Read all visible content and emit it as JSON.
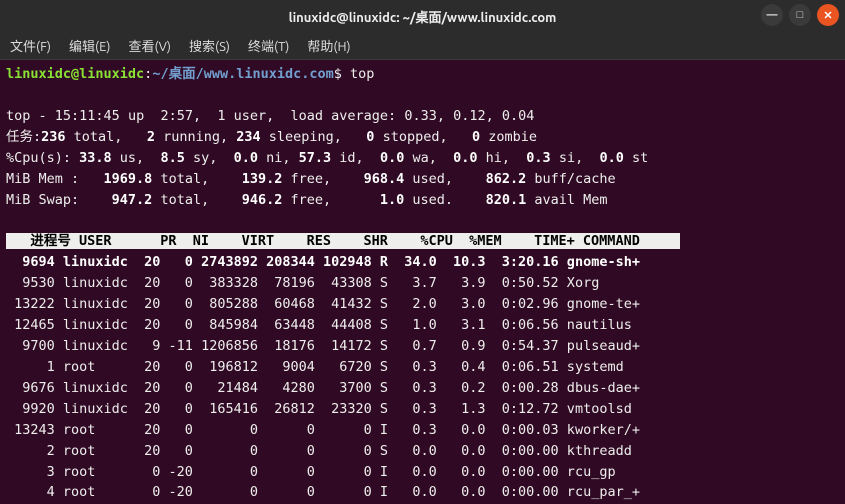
{
  "titlebar": {
    "title": "linuxidc@linuxidc: ~/桌面/www.linuxidc.com"
  },
  "window_controls": {
    "min": "—",
    "max": "□",
    "close": "✕"
  },
  "menu": {
    "file": "文件(F)",
    "edit": "编辑(E)",
    "view": "查看(V)",
    "search": "搜索(S)",
    "terminal": "终端(T)",
    "help": "帮助(H)"
  },
  "prompt": {
    "userhost": "linuxidc@linuxidc",
    "colon": ":",
    "path": "~/桌面/www.linuxidc.com",
    "dollar": "$",
    "command": "top"
  },
  "top_summary": {
    "line1_prefix": "top - ",
    "time": "15:11:45",
    "up_label": " up  ",
    "uptime": "2:57",
    "users_sep": ",  ",
    "users": "1 user",
    "load_label": ",  load average: ",
    "load": "0.33, 0.12, 0.04",
    "tasks_label": "任务:",
    "tasks_total": "236",
    "tasks_total_lbl": " total,   ",
    "tasks_running": "2",
    "tasks_running_lbl": " running, ",
    "tasks_sleeping": "234",
    "tasks_sleeping_lbl": " sleeping,   ",
    "tasks_stopped": "0",
    "tasks_stopped_lbl": " stopped,   ",
    "tasks_zombie": "0",
    "tasks_zombie_lbl": " zombie",
    "cpu_label": "%Cpu(s): ",
    "cpu_us": "33.8",
    "cpu_us_lbl": " us,  ",
    "cpu_sy": "8.5",
    "cpu_sy_lbl": " sy,  ",
    "cpu_ni": "0.0",
    "cpu_ni_lbl": " ni, ",
    "cpu_id": "57.3",
    "cpu_id_lbl": " id,  ",
    "cpu_wa": "0.0",
    "cpu_wa_lbl": " wa,  ",
    "cpu_hi": "0.0",
    "cpu_hi_lbl": " hi,  ",
    "cpu_si": "0.3",
    "cpu_si_lbl": " si,  ",
    "cpu_st": "0.0",
    "cpu_st_lbl": " st",
    "mem_label": "MiB Mem :   ",
    "mem_total": "1969.8",
    "mem_total_lbl": " total,    ",
    "mem_free": "139.2",
    "mem_free_lbl": " free,    ",
    "mem_used": "968.4",
    "mem_used_lbl": " used,    ",
    "mem_buff": "862.2",
    "mem_buff_lbl": " buff/cache",
    "swap_label": "MiB Swap:    ",
    "swap_total": "947.2",
    "swap_total_lbl": " total,    ",
    "swap_free": "946.2",
    "swap_free_lbl": " free,      ",
    "swap_used": "1.0",
    "swap_used_lbl": " used.    ",
    "swap_avail": "820.1",
    "swap_avail_lbl": " avail Mem"
  },
  "columns": {
    "pid": "进程号",
    "user": "USER",
    "pr": "PR",
    "ni": "NI",
    "virt": "VIRT",
    "res": "RES",
    "shr": "SHR",
    "s": " ",
    "cpu": "%CPU",
    "mem": "%MEM",
    "time": "TIME+",
    "cmd": "COMMAND"
  },
  "processes": [
    {
      "pid": "9694",
      "user": "linuxidc",
      "pr": "20",
      "ni": "0",
      "virt": "2743892",
      "res": "208344",
      "shr": "102948",
      "s": "R",
      "cpu": "34.0",
      "mem": "10.3",
      "time": "3:20.16",
      "cmd": "gnome-sh+",
      "hl": true
    },
    {
      "pid": "9530",
      "user": "linuxidc",
      "pr": "20",
      "ni": "0",
      "virt": "383328",
      "res": "78196",
      "shr": "43308",
      "s": "S",
      "cpu": "3.7",
      "mem": "3.9",
      "time": "0:50.52",
      "cmd": "Xorg"
    },
    {
      "pid": "13222",
      "user": "linuxidc",
      "pr": "20",
      "ni": "0",
      "virt": "805288",
      "res": "60468",
      "shr": "41432",
      "s": "S",
      "cpu": "2.0",
      "mem": "3.0",
      "time": "0:02.96",
      "cmd": "gnome-te+"
    },
    {
      "pid": "12465",
      "user": "linuxidc",
      "pr": "20",
      "ni": "0",
      "virt": "845984",
      "res": "63448",
      "shr": "44408",
      "s": "S",
      "cpu": "1.0",
      "mem": "3.1",
      "time": "0:06.56",
      "cmd": "nautilus"
    },
    {
      "pid": "9700",
      "user": "linuxidc",
      "pr": "9",
      "ni": "-11",
      "virt": "1206856",
      "res": "18176",
      "shr": "14172",
      "s": "S",
      "cpu": "0.7",
      "mem": "0.9",
      "time": "0:54.37",
      "cmd": "pulseaud+"
    },
    {
      "pid": "1",
      "user": "root",
      "pr": "20",
      "ni": "0",
      "virt": "196812",
      "res": "9004",
      "shr": "6720",
      "s": "S",
      "cpu": "0.3",
      "mem": "0.4",
      "time": "0:06.51",
      "cmd": "systemd"
    },
    {
      "pid": "9676",
      "user": "linuxidc",
      "pr": "20",
      "ni": "0",
      "virt": "21484",
      "res": "4280",
      "shr": "3700",
      "s": "S",
      "cpu": "0.3",
      "mem": "0.2",
      "time": "0:00.28",
      "cmd": "dbus-dae+"
    },
    {
      "pid": "9920",
      "user": "linuxidc",
      "pr": "20",
      "ni": "0",
      "virt": "165416",
      "res": "26812",
      "shr": "23320",
      "s": "S",
      "cpu": "0.3",
      "mem": "1.3",
      "time": "0:12.72",
      "cmd": "vmtoolsd"
    },
    {
      "pid": "13243",
      "user": "root",
      "pr": "20",
      "ni": "0",
      "virt": "0",
      "res": "0",
      "shr": "0",
      "s": "I",
      "cpu": "0.3",
      "mem": "0.0",
      "time": "0:00.03",
      "cmd": "kworker/+"
    },
    {
      "pid": "2",
      "user": "root",
      "pr": "20",
      "ni": "0",
      "virt": "0",
      "res": "0",
      "shr": "0",
      "s": "S",
      "cpu": "0.0",
      "mem": "0.0",
      "time": "0:00.00",
      "cmd": "kthreadd"
    },
    {
      "pid": "3",
      "user": "root",
      "pr": "0",
      "ni": "-20",
      "virt": "0",
      "res": "0",
      "shr": "0",
      "s": "I",
      "cpu": "0.0",
      "mem": "0.0",
      "time": "0:00.00",
      "cmd": "rcu_gp"
    },
    {
      "pid": "4",
      "user": "root",
      "pr": "0",
      "ni": "-20",
      "virt": "0",
      "res": "0",
      "shr": "0",
      "s": "I",
      "cpu": "0.0",
      "mem": "0.0",
      "time": "0:00.00",
      "cmd": "rcu_par_+"
    }
  ]
}
